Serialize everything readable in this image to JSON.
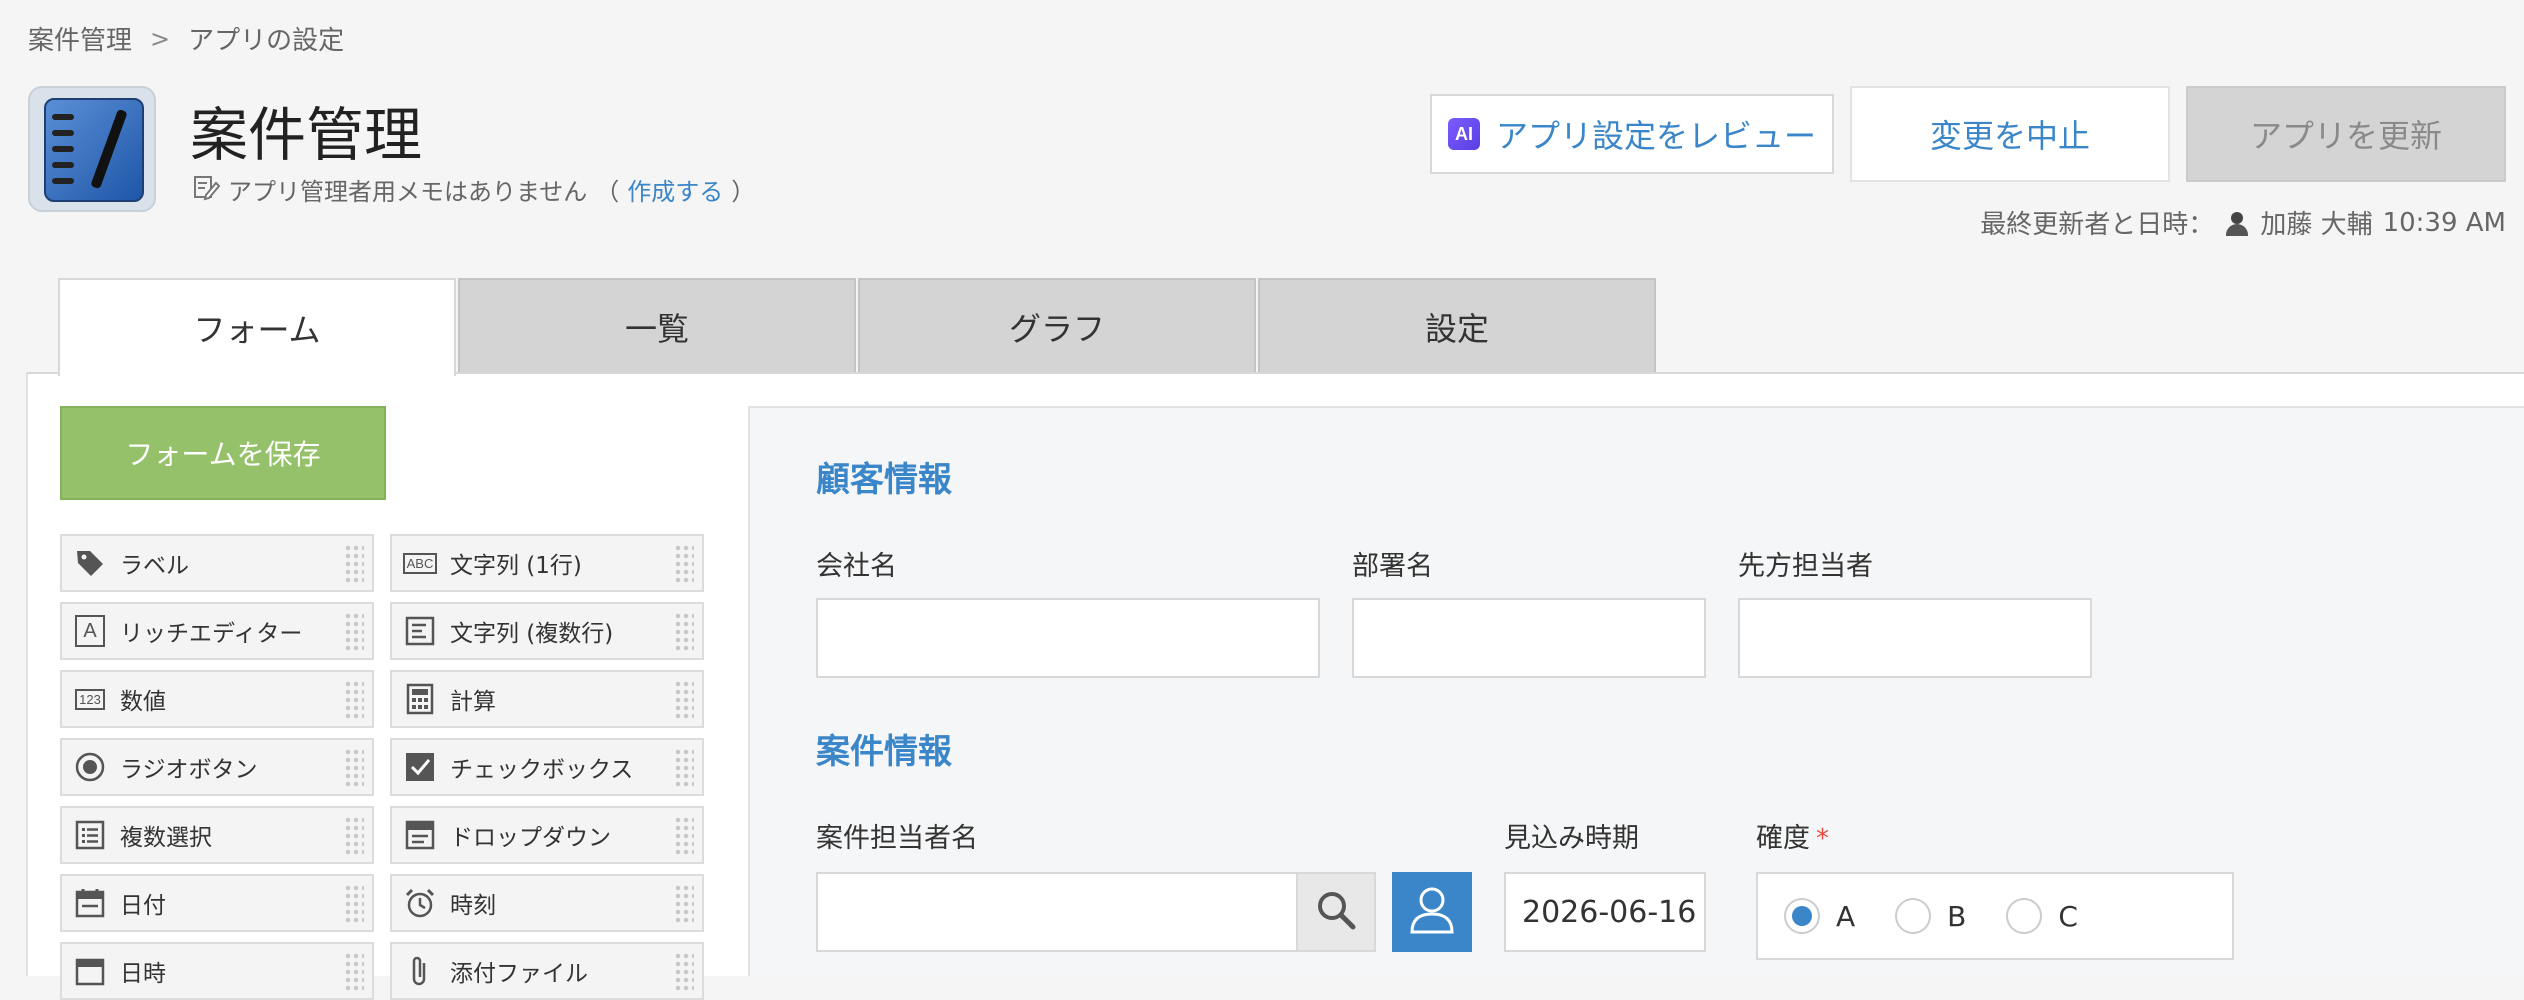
{
  "breadcrumb": {
    "root": "案件管理",
    "separator": ">",
    "current": "アプリの設定"
  },
  "app": {
    "title": "案件管理",
    "memo_text": "アプリ管理者用メモはありません",
    "memo_paren_open": "（",
    "memo_link": "作成する",
    "memo_paren_close": "）"
  },
  "header_buttons": {
    "ai_badge": "AI",
    "review": "アプリ設定をレビュー",
    "cancel": "変更を中止",
    "update": "アプリを更新"
  },
  "last_updated": {
    "label": "最終更新者と日時：",
    "user": "加藤 大輔",
    "time": "10:39 AM"
  },
  "tabs": [
    {
      "label": "フォーム",
      "active": true
    },
    {
      "label": "一覧",
      "active": false
    },
    {
      "label": "グラフ",
      "active": false
    },
    {
      "label": "設定",
      "active": false
    }
  ],
  "save_form": "フォームを保存",
  "palette": [
    {
      "label": "ラベル",
      "icon": "tag-icon"
    },
    {
      "label": "文字列 (1行)",
      "icon": "abc-icon"
    },
    {
      "label": "リッチエディター",
      "icon": "rich-editor-icon"
    },
    {
      "label": "文字列 (複数行)",
      "icon": "multiline-icon"
    },
    {
      "label": "数値",
      "icon": "number-icon"
    },
    {
      "label": "計算",
      "icon": "calculator-icon"
    },
    {
      "label": "ラジオボタン",
      "icon": "radio-icon"
    },
    {
      "label": "チェックボックス",
      "icon": "checkbox-icon"
    },
    {
      "label": "複数選択",
      "icon": "multi-select-icon"
    },
    {
      "label": "ドロップダウン",
      "icon": "dropdown-icon"
    },
    {
      "label": "日付",
      "icon": "calendar-icon"
    },
    {
      "label": "時刻",
      "icon": "clock-icon"
    },
    {
      "label": "日時",
      "icon": "datetime-icon"
    },
    {
      "label": "添付ファイル",
      "icon": "paperclip-icon"
    }
  ],
  "icon_text": {
    "abc": "ABC",
    "rich": "A",
    "num": "123"
  },
  "form": {
    "section_customer": "顧客情報",
    "company_label": "会社名",
    "department_label": "部署名",
    "contact_label": "先方担当者",
    "section_deal": "案件情報",
    "deal_owner_label": "案件担当者名",
    "forecast_label": "見込み時期",
    "forecast_value": "2026-06-16",
    "certainty_label": "確度",
    "required_mark": "*",
    "certainty_options": [
      "A",
      "B",
      "C"
    ],
    "certainty_selected": "A"
  },
  "colors": {
    "accent": "#3a86c8",
    "save_green": "#96c16b",
    "required": "#e74c3c"
  }
}
